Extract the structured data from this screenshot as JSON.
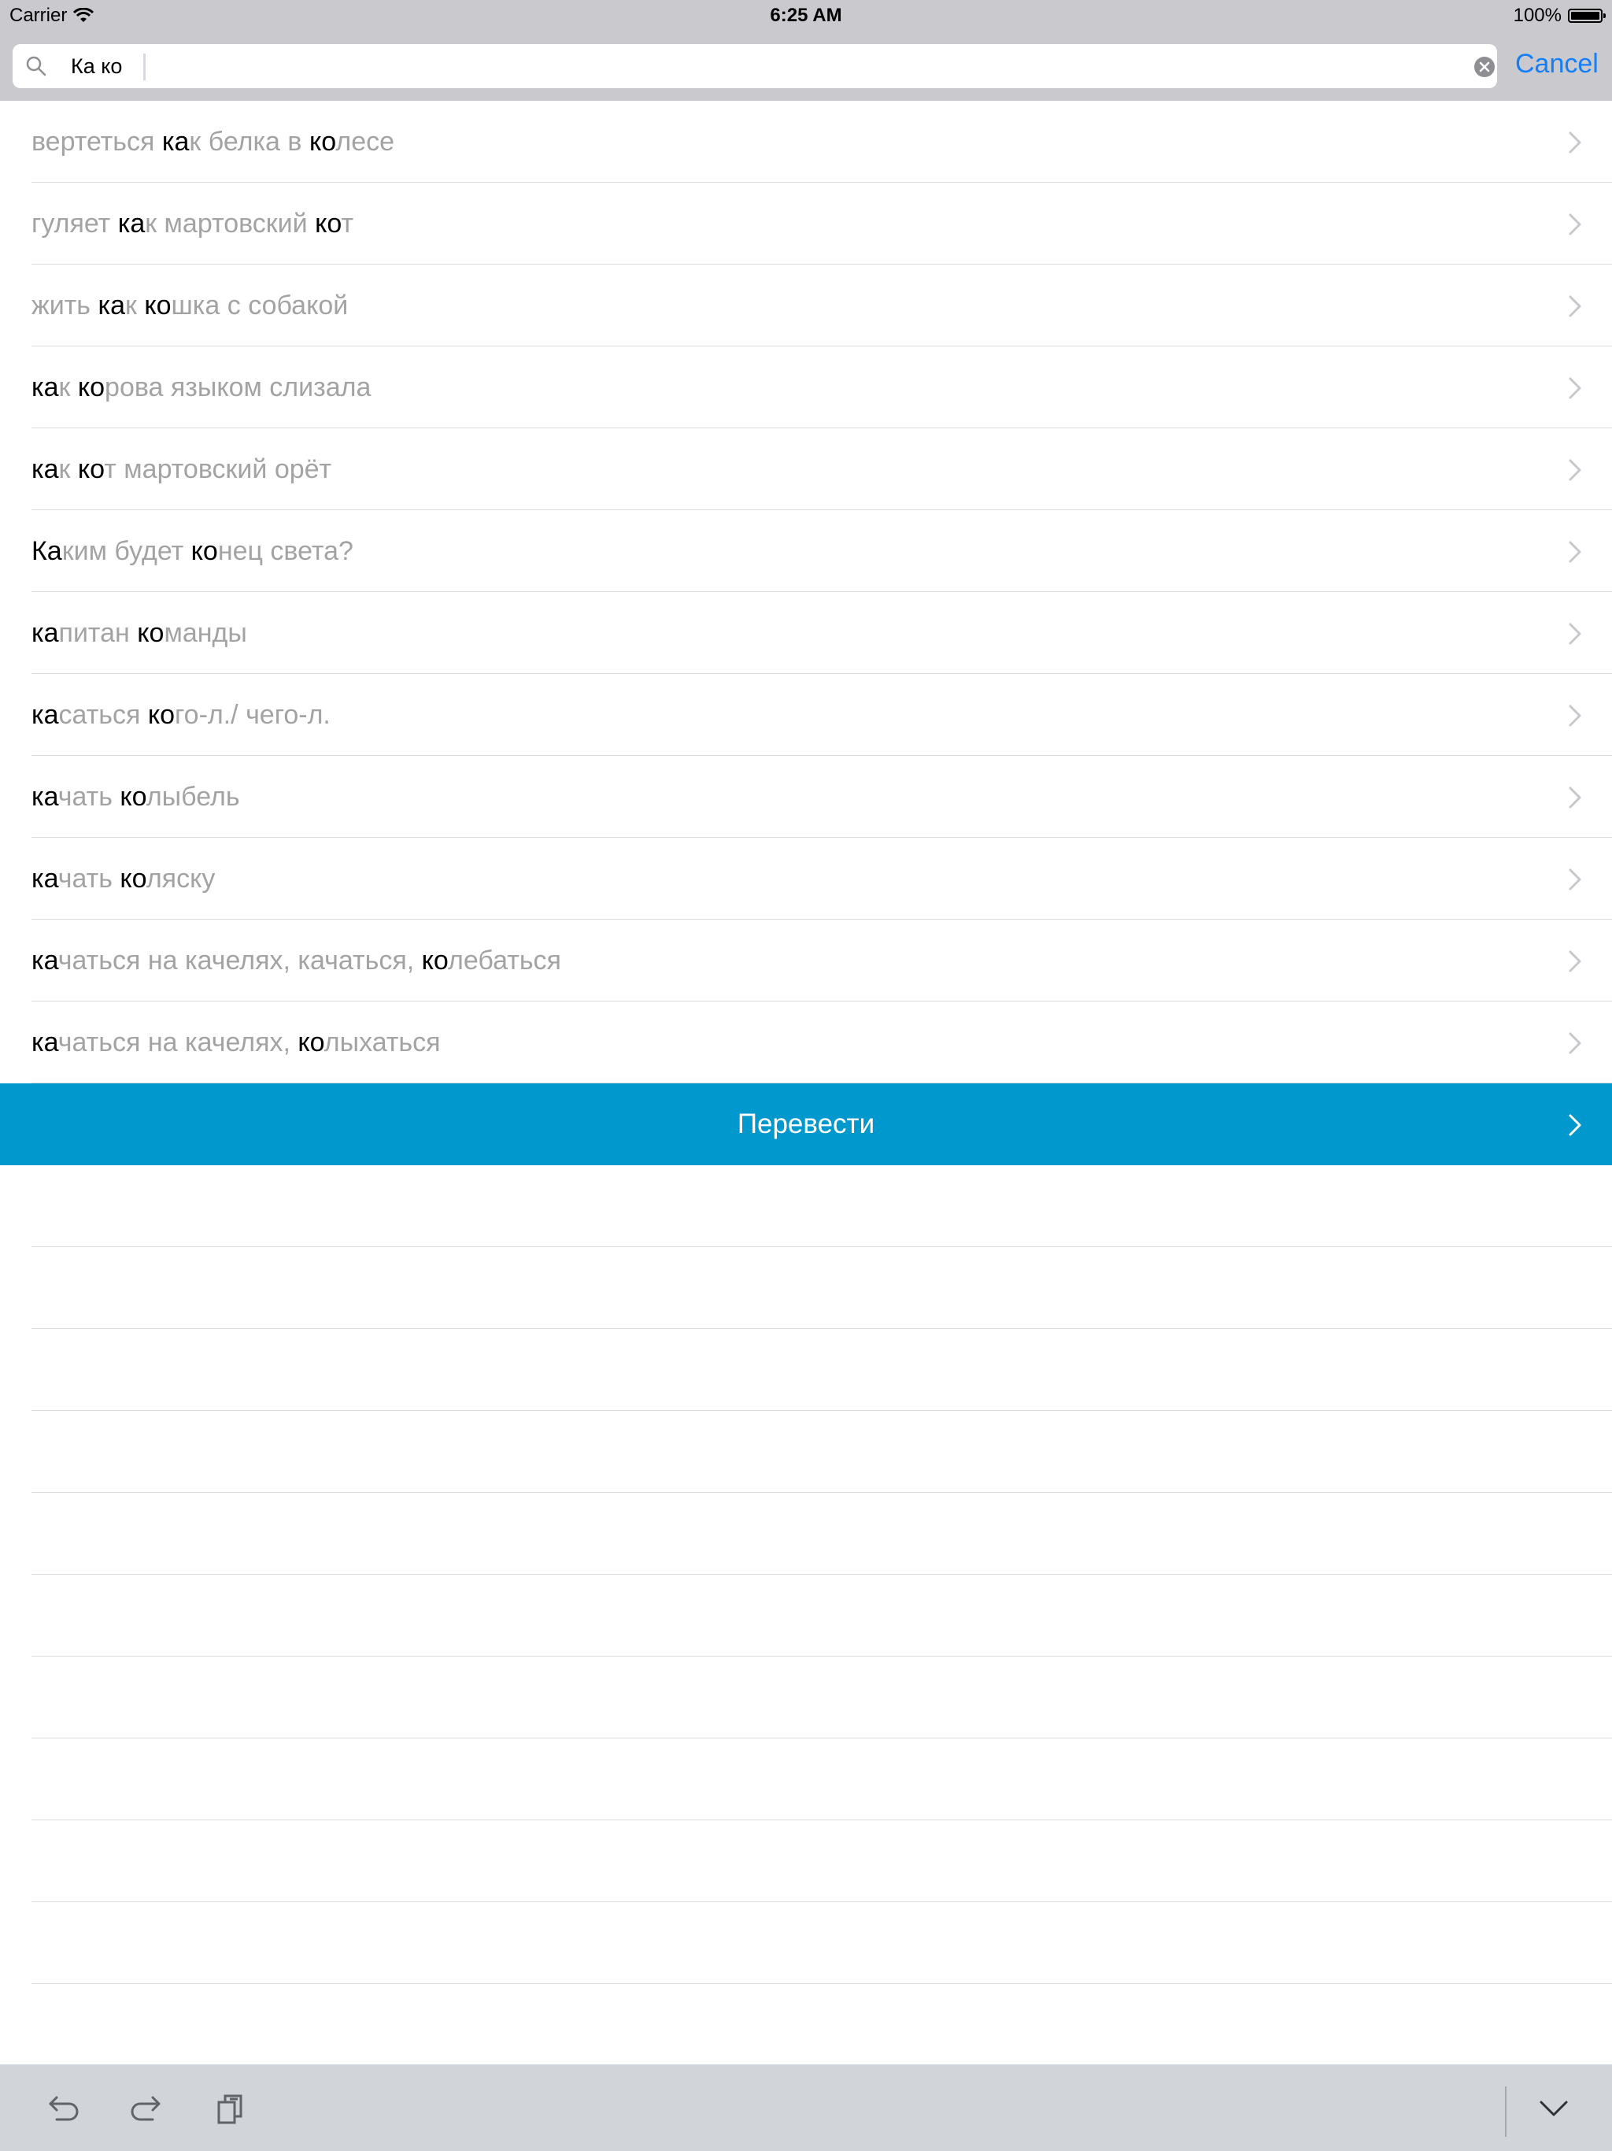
{
  "status_bar": {
    "carrier": "Carrier",
    "time": "6:25 AM",
    "battery": "100%"
  },
  "search": {
    "value": "Ка ко",
    "cancel_label": "Cancel"
  },
  "results": [
    {
      "parts": [
        [
          "вертеться ",
          false
        ],
        [
          "ка",
          true
        ],
        [
          "к белка в ",
          false
        ],
        [
          "ко",
          true
        ],
        [
          "лесе",
          false
        ]
      ]
    },
    {
      "parts": [
        [
          "гуляет ",
          false
        ],
        [
          "ка",
          true
        ],
        [
          "к мартовский ",
          false
        ],
        [
          "ко",
          true
        ],
        [
          "т",
          false
        ]
      ]
    },
    {
      "parts": [
        [
          "жить ",
          false
        ],
        [
          "ка",
          true
        ],
        [
          "к ",
          false
        ],
        [
          "ко",
          true
        ],
        [
          "шка с собакой",
          false
        ]
      ]
    },
    {
      "parts": [
        [
          "ка",
          true
        ],
        [
          "к ",
          false
        ],
        [
          "ко",
          true
        ],
        [
          "рова языком слизала",
          false
        ]
      ]
    },
    {
      "parts": [
        [
          "ка",
          true
        ],
        [
          "к ",
          false
        ],
        [
          "ко",
          true
        ],
        [
          "т мартовский орёт",
          false
        ]
      ]
    },
    {
      "parts": [
        [
          "Ка",
          true
        ],
        [
          "ким будет ",
          false
        ],
        [
          "ко",
          true
        ],
        [
          "нец света?",
          false
        ]
      ]
    },
    {
      "parts": [
        [
          "ка",
          true
        ],
        [
          "питан ",
          false
        ],
        [
          "ко",
          true
        ],
        [
          "манды",
          false
        ]
      ]
    },
    {
      "parts": [
        [
          "ка",
          true
        ],
        [
          "саться ",
          false
        ],
        [
          "ко",
          true
        ],
        [
          "го-л./ чего-л.",
          false
        ]
      ]
    },
    {
      "parts": [
        [
          "ка",
          true
        ],
        [
          "чать ",
          false
        ],
        [
          "ко",
          true
        ],
        [
          "лыбель",
          false
        ]
      ]
    },
    {
      "parts": [
        [
          "ка",
          true
        ],
        [
          "чать ",
          false
        ],
        [
          "ко",
          true
        ],
        [
          "ляску",
          false
        ]
      ]
    },
    {
      "parts": [
        [
          "ка",
          true
        ],
        [
          "чаться на качелях, качаться, ",
          false
        ],
        [
          "ко",
          true
        ],
        [
          "лебаться",
          false
        ]
      ]
    },
    {
      "parts": [
        [
          "ка",
          true
        ],
        [
          "чаться на качелях, ",
          false
        ],
        [
          "ко",
          true
        ],
        [
          "лыхаться",
          false
        ]
      ]
    }
  ],
  "translate": {
    "label": "Перевести"
  },
  "empty_rows": 11,
  "toolbar": {
    "icons": [
      "undo-icon",
      "redo-icon",
      "paste-icon",
      "chevron-down-icon"
    ]
  },
  "colors": {
    "accent": "#0199cd",
    "link": "#147efb",
    "muted_text": "#a3a3a3",
    "highlight_text": "#000000",
    "bar_background": "#c9c9ce",
    "toolbar_background": "#d1d4d9"
  }
}
